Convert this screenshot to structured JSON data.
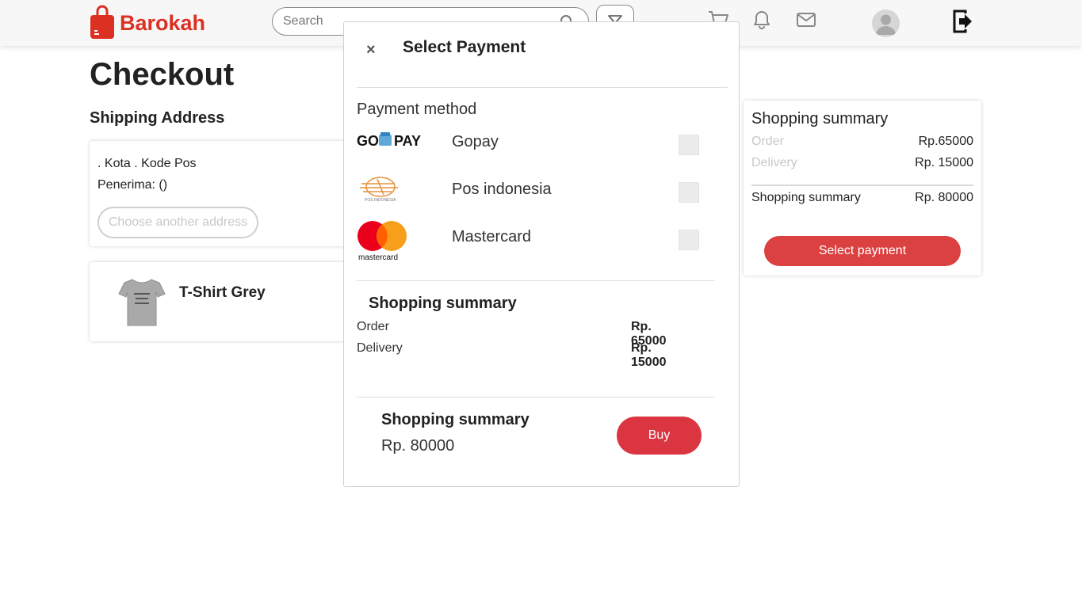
{
  "header": {
    "brand": "Barokah",
    "search_placeholder": "Search"
  },
  "main": {
    "title": "Checkout",
    "shipping_title": "Shipping Address",
    "address_line1": ". Kota . Kode Pos",
    "address_line2": "Penerima: ()",
    "choose_address_label": "Choose another address",
    "product_name": "T-Shirt Grey"
  },
  "summary": {
    "title": "Shopping summary",
    "order_label": "Order",
    "order_value": "Rp.65000",
    "delivery_label": "Delivery",
    "delivery_value": "Rp. 15000",
    "total_label": "Shopping summary",
    "total_value": "Rp. 80000",
    "select_payment_label": "Select payment"
  },
  "modal": {
    "close_label": "×",
    "title": "Select Payment",
    "payment_method_title": "Payment method",
    "methods": [
      {
        "name": "Gopay",
        "logo_text": "GOPAY"
      },
      {
        "name": "Pos indonesia",
        "logo_text": "POS INDONESIA"
      },
      {
        "name": "Mastercard",
        "logo_text": "mastercard"
      }
    ],
    "summary_title": "Shopping summary",
    "order_label": "Order",
    "order_value": "Rp. 65000",
    "delivery_label": "Delivery",
    "delivery_value": "Rp. 15000",
    "final_title": "Shopping summary",
    "final_total": "Rp. 80000",
    "buy_label": "Buy"
  },
  "colors": {
    "brand_red": "#db3022",
    "button_red": "#db4141"
  }
}
